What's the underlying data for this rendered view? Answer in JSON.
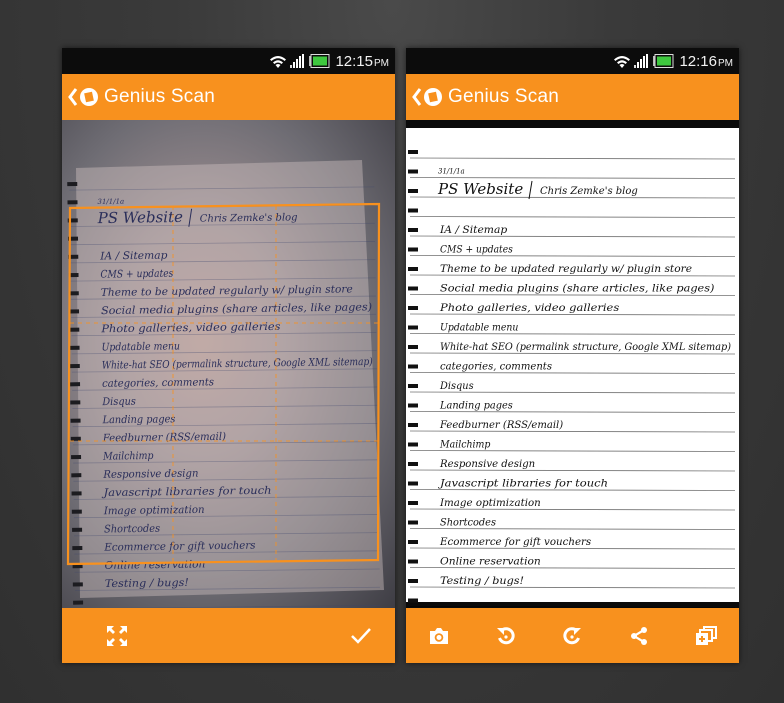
{
  "screens": [
    {
      "id": "crop",
      "status": {
        "time": "12:15",
        "ampm": "PM"
      },
      "appbar": {
        "title": "Genius Scan"
      },
      "bottom_actions": [
        {
          "name": "expand-frame-button",
          "icon": "expand-arrows-icon"
        },
        {
          "name": "confirm-crop-button",
          "icon": "checkmark-icon"
        }
      ]
    },
    {
      "id": "result",
      "status": {
        "time": "12:16",
        "ampm": "PM"
      },
      "appbar": {
        "title": "Genius Scan"
      },
      "bottom_actions": [
        {
          "name": "camera-button",
          "icon": "camera-icon"
        },
        {
          "name": "rotate-left-button",
          "icon": "rotate-left-icon"
        },
        {
          "name": "rotate-right-button",
          "icon": "rotate-right-icon"
        },
        {
          "name": "share-button",
          "icon": "share-icon"
        },
        {
          "name": "add-pages-button",
          "icon": "add-pages-icon"
        }
      ]
    }
  ],
  "note": {
    "date": "31/1/1a",
    "heading": "PS Website",
    "heading_right": "Chris Zemke's blog",
    "lines": [
      "IA / Sitemap",
      "CMS + updates",
      "Theme to be updated regularly w/ plugin store",
      "Social media plugins (share articles, like pages)",
      "Photo galleries, video galleries",
      "Updatable menu",
      "White-hat SEO (permalink structure, Google XML sitemap)",
      "categories, comments",
      "Disqus",
      "Landing pages",
      "Feedburner (RSS/email)",
      "Mailchimp",
      "Responsive design",
      "Javascript libraries for touch",
      "Image optimization",
      "Shortcodes",
      "Ecommerce for gift vouchers",
      "Online reservation",
      "Testing / bugs!"
    ]
  },
  "colors": {
    "accent": "#f8911e",
    "statusbar": "#0c0c0c",
    "background": "#3a3a3a"
  }
}
